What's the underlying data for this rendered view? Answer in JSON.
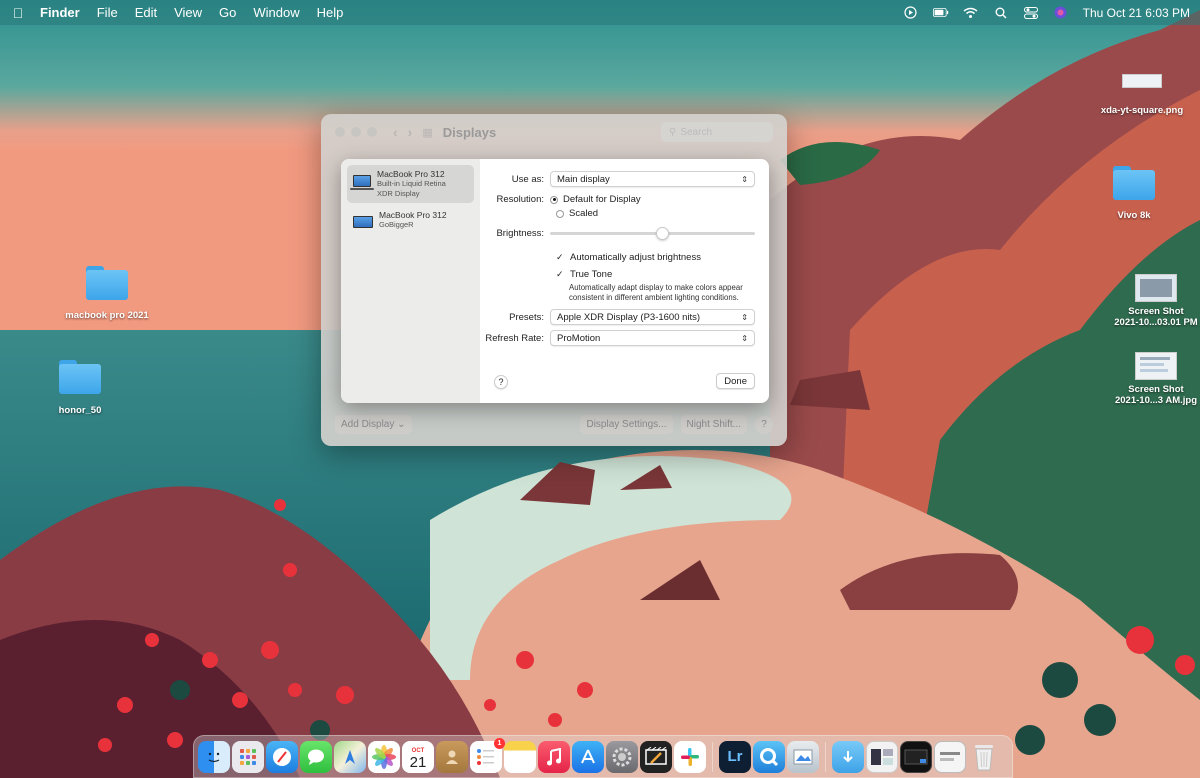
{
  "menubar": {
    "app": "Finder",
    "items": [
      "File",
      "Edit",
      "View",
      "Go",
      "Window",
      "Help"
    ],
    "clock": "Thu Oct 21  6:03 PM"
  },
  "desktop": {
    "icons": [
      {
        "label": "macbook pro 2021"
      },
      {
        "label": "honor_50"
      },
      {
        "label": "xda-yt-square.png"
      },
      {
        "label": "Vivo 8k"
      },
      {
        "label": "Screen Shot\n2021-10...03.01 PM"
      },
      {
        "label": "Screen Shot\n2021-10...3 AM.jpg"
      }
    ]
  },
  "back_window": {
    "title": "Displays",
    "search_placeholder": "Search",
    "add_display": "Add Display",
    "display_settings": "Display Settings...",
    "night_shift": "Night Shift...",
    "help": "?"
  },
  "sheet": {
    "displays": [
      {
        "name": "MacBook Pro 312",
        "line2": "Built-in Liquid Retina",
        "line3": "XDR Display"
      },
      {
        "name": "MacBook Pro 312",
        "line2": "GoBiggeR",
        "line3": ""
      }
    ],
    "use_as_label": "Use as:",
    "use_as_value": "Main display",
    "resolution_label": "Resolution:",
    "resolution_default": "Default for Display",
    "resolution_scaled": "Scaled",
    "brightness_label": "Brightness:",
    "brightness_level": 0.55,
    "auto_brightness": "Automatically adjust brightness",
    "true_tone": "True Tone",
    "true_tone_hint": "Automatically adapt display to make colors appear consistent in different ambient lighting conditions.",
    "presets_label": "Presets:",
    "presets_value": "Apple XDR Display (P3-1600 nits)",
    "refresh_label": "Refresh Rate:",
    "refresh_value": "ProMotion",
    "help": "?",
    "done": "Done"
  },
  "dock": {
    "calendar_month": "OCT",
    "calendar_day": "21",
    "reminders_badge": "1",
    "lightroom": "Lr"
  },
  "colors": {
    "accent": "#2f7fe0",
    "folder": "#4fb2f0"
  }
}
